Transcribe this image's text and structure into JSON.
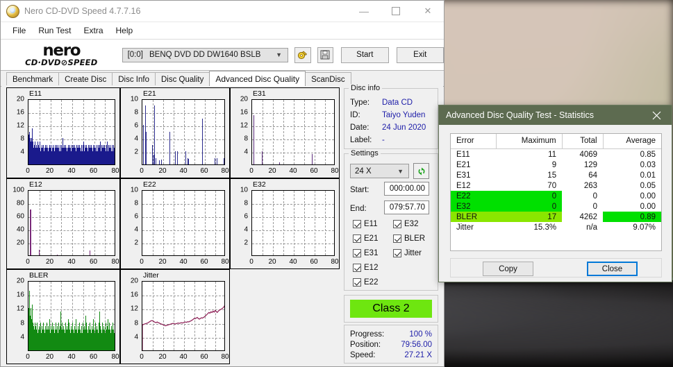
{
  "window": {
    "title": "Nero CD-DVD Speed 4.7.7.16",
    "icon": "nero-disc-icon",
    "controls": {
      "minimize": "—",
      "maximize": "□",
      "close": "✕"
    }
  },
  "menu": {
    "items": [
      "File",
      "Run Test",
      "Extra",
      "Help"
    ]
  },
  "brand": {
    "line1": "nero",
    "line2": "CD·DVD⊘SPEED"
  },
  "toolbar": {
    "drive_index": "[0:0]",
    "drive_name": "BENQ DVD DD DW1640 BSLB",
    "dropdown_icon": "chevron-down-icon",
    "disc_button_icon": "disc-tool-icon",
    "save_button_icon": "floppy-save-icon",
    "start_label": "Start",
    "exit_label": "Exit"
  },
  "tabs": {
    "items": [
      "Benchmark",
      "Create Disc",
      "Disc Info",
      "Disc Quality",
      "Advanced Disc Quality",
      "ScanDisc"
    ],
    "active": "Advanced Disc Quality"
  },
  "disc_info": {
    "legend": "Disc info",
    "rows": [
      {
        "key": "Type:",
        "value": "Data CD"
      },
      {
        "key": "ID:",
        "value": "Taiyo Yuden"
      },
      {
        "key": "Date:",
        "value": "24 Jun 2020"
      },
      {
        "key": "Label:",
        "value": "-"
      }
    ]
  },
  "settings": {
    "legend": "Settings",
    "speed_value": "24 X",
    "dropdown_icon": "chevron-down-icon",
    "refresh_icon": "refresh-green-icon",
    "start_label": "Start:",
    "start_value": "000:00.00",
    "end_label": "End:",
    "end_value": "079:57.70",
    "checkboxes_left": [
      {
        "label": "E11",
        "checked": true
      },
      {
        "label": "E21",
        "checked": true
      },
      {
        "label": "E31",
        "checked": true
      },
      {
        "label": "E12",
        "checked": true
      },
      {
        "label": "E22",
        "checked": true
      }
    ],
    "checkboxes_right": [
      {
        "label": "E32",
        "checked": true
      },
      {
        "label": "BLER",
        "checked": true
      },
      {
        "label": "Jitter",
        "checked": true
      }
    ]
  },
  "quality": {
    "class_label": "Class 2",
    "class_color": "#6ee610"
  },
  "progress": {
    "rows": [
      {
        "key": "Progress:",
        "value": "100 %"
      },
      {
        "key": "Position:",
        "value": "79:56.00"
      },
      {
        "key": "Speed:",
        "value": "27.21 X"
      }
    ]
  },
  "statistics_dialog": {
    "title": "Advanced Disc Quality Test - Statistics",
    "close_icon": "close-icon",
    "columns": [
      "Error",
      "Maximum",
      "Total",
      "Average"
    ],
    "rows": [
      {
        "error": "E11",
        "maximum": "11",
        "total": "4069",
        "average": "0.85",
        "highlight": "none"
      },
      {
        "error": "E21",
        "maximum": "9",
        "total": "129",
        "average": "0.03",
        "highlight": "none"
      },
      {
        "error": "E31",
        "maximum": "15",
        "total": "64",
        "average": "0.01",
        "highlight": "none"
      },
      {
        "error": "E12",
        "maximum": "70",
        "total": "263",
        "average": "0.05",
        "highlight": "none"
      },
      {
        "error": "E22",
        "maximum": "0",
        "total": "0",
        "average": "0.00",
        "highlight": "bright-left"
      },
      {
        "error": "E32",
        "maximum": "0",
        "total": "0",
        "average": "0.00",
        "highlight": "bright-left"
      },
      {
        "error": "BLER",
        "maximum": "17",
        "total": "4262",
        "average": "0.89",
        "highlight": "lime-left-bright-avg"
      },
      {
        "error": "Jitter",
        "maximum": "15.3%",
        "total": "n/a",
        "average": "9.07%",
        "highlight": "none"
      }
    ],
    "copy_label": "Copy",
    "close_label": "Close"
  },
  "chart_data": [
    {
      "type": "area",
      "title": "E11",
      "ylim": [
        0,
        20
      ],
      "xlim": [
        0,
        80
      ],
      "yticks": [
        4,
        8,
        12,
        16,
        20
      ],
      "xticks": [
        0,
        20,
        40,
        60,
        80
      ],
      "color": "#1a1a8c",
      "grid": true,
      "xlabel": "",
      "ylabel": "",
      "values": [
        6,
        9,
        7,
        10,
        8,
        6,
        7,
        5,
        8,
        6,
        9,
        11,
        7,
        6,
        4,
        5,
        3,
        6,
        4,
        7,
        3,
        5,
        4,
        6,
        3,
        5,
        7,
        4,
        3,
        6,
        4,
        5,
        3,
        7,
        4,
        3,
        5,
        4,
        6,
        3,
        4,
        5,
        3,
        6,
        4,
        3,
        5,
        4,
        3,
        6,
        4,
        5,
        3,
        4,
        6,
        3,
        5,
        4,
        3,
        5,
        4,
        6,
        3,
        4,
        5,
        3,
        6,
        4,
        3,
        5,
        4,
        3,
        6,
        4,
        5,
        3,
        4,
        6,
        3,
        5,
        4,
        6,
        3,
        5,
        4,
        3,
        6,
        4,
        5,
        3,
        4,
        6,
        5,
        3,
        4,
        6,
        3,
        5,
        4,
        8,
        3,
        5,
        4,
        3,
        6,
        4,
        5,
        3,
        4,
        6,
        3,
        5,
        4,
        3,
        5,
        4,
        6,
        3,
        4,
        5,
        3,
        6,
        4,
        5,
        3,
        4,
        6,
        3,
        5,
        4,
        3,
        6,
        5,
        4,
        3,
        6,
        4,
        5,
        3,
        4,
        6,
        3,
        5,
        4,
        6,
        3,
        4,
        5,
        3,
        6,
        4,
        5,
        3,
        4,
        6,
        3,
        5,
        4,
        3,
        6,
        4,
        5,
        7,
        3,
        4,
        6,
        3,
        5,
        4,
        3,
        6,
        4,
        5,
        3,
        4,
        6,
        3,
        5,
        4,
        6,
        3,
        5,
        4,
        3,
        6,
        4,
        5,
        3,
        4,
        6,
        3,
        5,
        4,
        3,
        6,
        4,
        5,
        3,
        4,
        6,
        5,
        3,
        4,
        6,
        3,
        5,
        4,
        3,
        6,
        4,
        7,
        5,
        3,
        4,
        6,
        3,
        5,
        4,
        6,
        3,
        5,
        4,
        3,
        6,
        4,
        5,
        3,
        4,
        6,
        3,
        5,
        7,
        4,
        3,
        6,
        4,
        5,
        3,
        4,
        6,
        3,
        5,
        4,
        3,
        6,
        5,
        4,
        3,
        6,
        4,
        5,
        3,
        4,
        6,
        3,
        5,
        8
      ]
    },
    {
      "type": "bar",
      "title": "E21",
      "ylim": [
        0,
        10
      ],
      "xlim": [
        0,
        80
      ],
      "yticks": [
        2,
        4,
        6,
        8,
        10
      ],
      "xticks": [
        0,
        20,
        40,
        60,
        80
      ],
      "color": "#2a2a8c",
      "grid": true,
      "points": [
        [
          0.5,
          6
        ],
        [
          2.5,
          9
        ],
        [
          3.5,
          5
        ],
        [
          9,
          3
        ],
        [
          10.5,
          1.5
        ],
        [
          11.5,
          9
        ],
        [
          12.5,
          1
        ],
        [
          16,
          0.6
        ],
        [
          18,
          0.7
        ],
        [
          26,
          5
        ],
        [
          31,
          2
        ],
        [
          33,
          2
        ],
        [
          41,
          2
        ],
        [
          43,
          1
        ],
        [
          44,
          0.8
        ],
        [
          57.5,
          7
        ],
        [
          69,
          1
        ],
        [
          71,
          1
        ],
        [
          78,
          1
        ],
        [
          79,
          2
        ]
      ]
    },
    {
      "type": "bar",
      "title": "E31",
      "ylim": [
        0,
        20
      ],
      "xlim": [
        0,
        80
      ],
      "yticks": [
        4,
        8,
        12,
        16,
        20
      ],
      "xticks": [
        0,
        20,
        40,
        60,
        80
      ],
      "color": "#5a2a7a",
      "grid": true,
      "points": [
        [
          1.5,
          15
        ],
        [
          9.5,
          4
        ],
        [
          26,
          0.6
        ],
        [
          57,
          3.2
        ]
      ]
    },
    {
      "type": "bar",
      "title": "E12",
      "ylim": [
        0,
        100
      ],
      "xlim": [
        0,
        80
      ],
      "yticks": [
        20,
        40,
        60,
        80,
        100
      ],
      "xticks": [
        0,
        20,
        40,
        60,
        80
      ],
      "color": "#7a2a7a",
      "grid": true,
      "points": [
        [
          1.5,
          70
        ],
        [
          9.5,
          8
        ],
        [
          26,
          1.5
        ],
        [
          56,
          7
        ]
      ]
    },
    {
      "type": "bar",
      "title": "E22",
      "ylim": [
        0,
        10
      ],
      "xlim": [
        0,
        80
      ],
      "yticks": [
        2,
        4,
        6,
        8,
        10
      ],
      "xticks": [
        0,
        20,
        40,
        60,
        80
      ],
      "color": "#2a2a8c",
      "grid": true,
      "points": []
    },
    {
      "type": "bar",
      "title": "E32",
      "ylim": [
        0,
        10
      ],
      "xlim": [
        0,
        80
      ],
      "yticks": [
        2,
        4,
        6,
        8,
        10
      ],
      "xticks": [
        0,
        20,
        40,
        60,
        80
      ],
      "color": "#2a2a8c",
      "grid": true,
      "points": []
    },
    {
      "type": "area",
      "title": "BLER",
      "ylim": [
        0,
        20
      ],
      "xlim": [
        0,
        80
      ],
      "yticks": [
        4,
        8,
        12,
        16,
        20
      ],
      "xticks": [
        0,
        20,
        40,
        60,
        80
      ],
      "color": "#128a12",
      "grid": true,
      "values": [
        8,
        12,
        17,
        14,
        10,
        8,
        12,
        6,
        9,
        7,
        13,
        9,
        6,
        8,
        5,
        7,
        4,
        6,
        8,
        5,
        4,
        7,
        3,
        6,
        4,
        8,
        5,
        3,
        6,
        4,
        7,
        5,
        3,
        6,
        8,
        4,
        5,
        3,
        7,
        4,
        6,
        3,
        5,
        8,
        4,
        6,
        3,
        5,
        7,
        4,
        6,
        3,
        5,
        8,
        4,
        6,
        3,
        5,
        7,
        4,
        6,
        3,
        9,
        5,
        4,
        7,
        3,
        6,
        4,
        8,
        5,
        3,
        6,
        4,
        7,
        5,
        3,
        6,
        4,
        8,
        5,
        3,
        6,
        4,
        7,
        3,
        5,
        8,
        4,
        6,
        3,
        5,
        7,
        4,
        11,
        6,
        3,
        5,
        8,
        4,
        6,
        3,
        5,
        7,
        4,
        6,
        3,
        5,
        8,
        4,
        6,
        3,
        5,
        7,
        4,
        6,
        9,
        3,
        5,
        8,
        4,
        6,
        3,
        5,
        7,
        4,
        6,
        3,
        5,
        8,
        4,
        6,
        3,
        5,
        7,
        4,
        6,
        3,
        9,
        5,
        4,
        6,
        3,
        5,
        7,
        4,
        6,
        3,
        5,
        8,
        4,
        6,
        3,
        5,
        7,
        4,
        6,
        3,
        5,
        8,
        4,
        6,
        3,
        5,
        7,
        4,
        6,
        10,
        3,
        5,
        8,
        4,
        6,
        3,
        5,
        7,
        4,
        6,
        3,
        5,
        8,
        4,
        6,
        3,
        5,
        7,
        4,
        6,
        3,
        9,
        5,
        4,
        6,
        3,
        5,
        8,
        4,
        6,
        3,
        5,
        7,
        4,
        6,
        3,
        5,
        8,
        4,
        6,
        11,
        3,
        5,
        7,
        4,
        6,
        3,
        5,
        8,
        4,
        6,
        3,
        5,
        7,
        4,
        6,
        3,
        5,
        8,
        4,
        6,
        3,
        5,
        7,
        9,
        4,
        6,
        3,
        5,
        8,
        4,
        6,
        3,
        5,
        7,
        4,
        6,
        3,
        5,
        8,
        4,
        6,
        3,
        5,
        7,
        4,
        6,
        3,
        8
      ]
    },
    {
      "type": "line",
      "title": "Jitter",
      "ylim": [
        0,
        20
      ],
      "xlim": [
        0,
        80
      ],
      "yticks": [
        4,
        8,
        12,
        16,
        20
      ],
      "xticks": [
        0,
        20,
        40,
        60,
        80
      ],
      "color": "#8b1a52",
      "grid": true,
      "values": [
        7.6,
        7.8,
        7.9,
        8.0,
        8.1,
        8.2,
        8.4,
        8.6,
        8.8,
        8.9,
        8.8,
        8.6,
        8.4,
        8.3,
        8.5,
        8.3,
        8.2,
        8.0,
        7.9,
        7.8,
        7.6,
        7.5,
        7.4,
        7.5,
        7.6,
        7.7,
        7.8,
        7.9,
        8.0,
        8.1,
        8.0,
        7.9,
        8.0,
        8.1,
        8.2,
        8.1,
        8.2,
        8.3,
        8.2,
        8.3,
        8.4,
        8.5,
        8.4,
        8.6,
        8.5,
        8.7,
        8.8,
        9.0,
        9.2,
        9.5,
        9.4,
        9.6,
        9.8,
        9.5,
        9.3,
        9.5,
        9.7,
        9.6,
        9.8,
        10.0,
        10.3,
        10.6,
        10.9,
        11.2,
        11.0,
        11.4,
        11.2,
        11.6,
        11.3,
        11.8,
        11.5,
        11.2,
        11.6,
        11.9,
        12.0,
        12.2,
        12.4,
        12.7,
        13.2,
        14.2
      ]
    }
  ]
}
